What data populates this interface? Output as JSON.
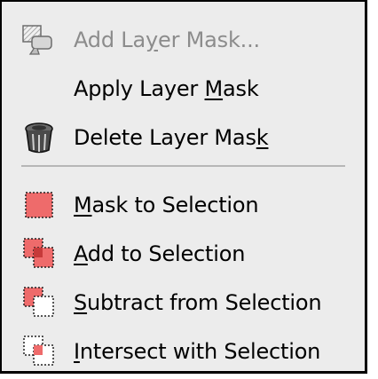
{
  "menu": {
    "items": [
      {
        "pre": "Add La",
        "u": "y",
        "post": "er Mask...",
        "icon": "add-layer-mask-icon",
        "disabled": true
      },
      {
        "pre": "Apply Layer ",
        "u": "M",
        "post": "ask",
        "icon": "",
        "disabled": false
      },
      {
        "pre": "Delete Layer Mas",
        "u": "k",
        "post": "",
        "icon": "trash-can-icon",
        "disabled": false
      },
      {
        "pre": "",
        "u": "M",
        "post": "ask to Selection",
        "icon": "mask-selection-icon",
        "disabled": false
      },
      {
        "pre": "",
        "u": "A",
        "post": "dd to Selection",
        "icon": "add-selection-icon",
        "disabled": false
      },
      {
        "pre": "",
        "u": "S",
        "post": "ubtract from Selection",
        "icon": "subtract-selection-icon",
        "disabled": false
      },
      {
        "pre": "",
        "u": "I",
        "post": "ntersect with Selection",
        "icon": "intersect-selection-icon",
        "disabled": false
      }
    ]
  },
  "colors": {
    "menu_bg": "#ececec",
    "disabled_text": "#8c8c8c",
    "selection_red": "#ee6b6b",
    "separator": "#b7b7b7"
  }
}
